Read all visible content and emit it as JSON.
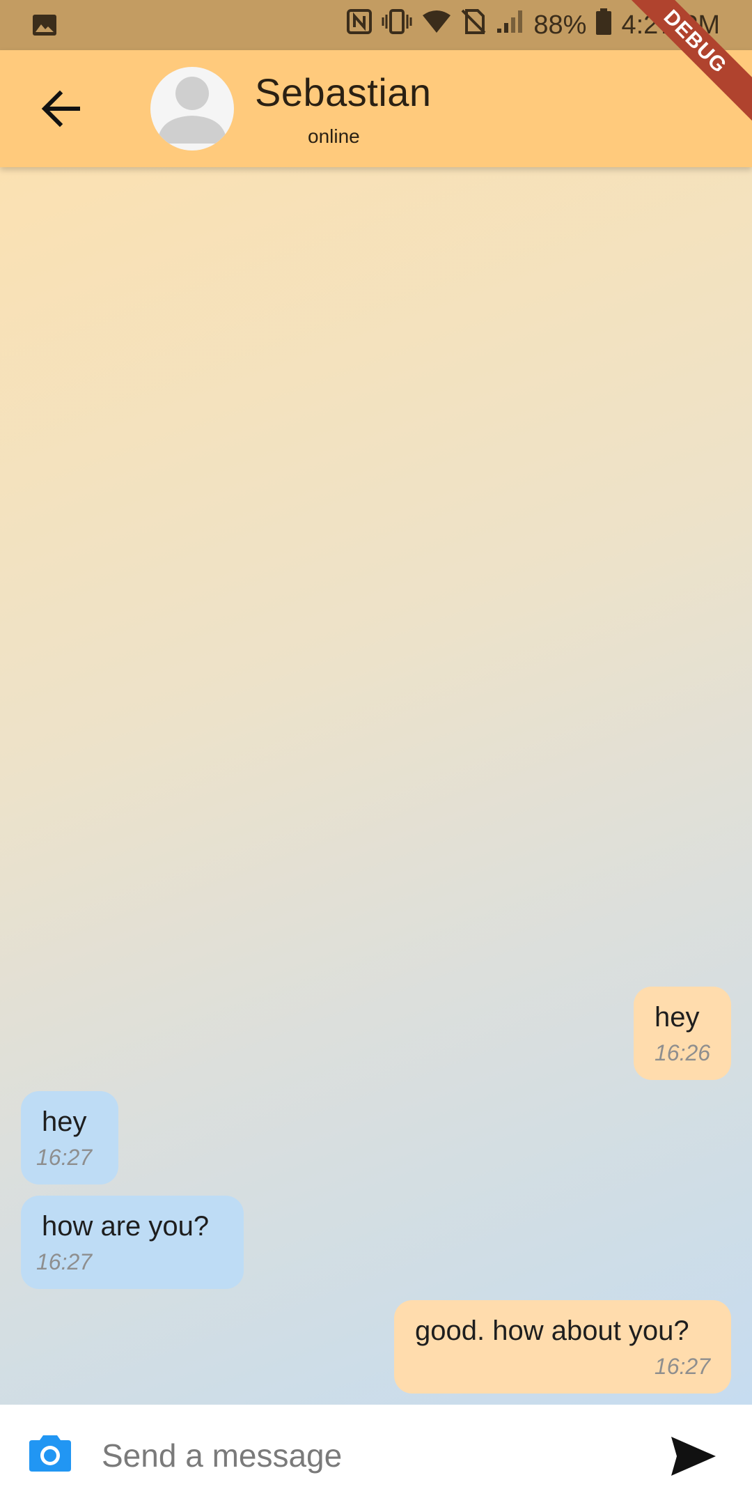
{
  "status_bar": {
    "battery": "88%",
    "time": "4:27 PM",
    "icons": [
      "image-icon",
      "nfc-icon",
      "vibrate-icon",
      "wifi-icon",
      "no-sim-icon",
      "signal-icon",
      "battery-icon"
    ]
  },
  "debug_banner": "DEBUG",
  "header": {
    "contact_name": "Sebastian",
    "contact_status": "online",
    "back_icon": "arrow-left-icon",
    "avatar_icon": "person-placeholder-icon"
  },
  "messages": [
    {
      "direction": "sent",
      "text": "hey",
      "time": "16:26"
    },
    {
      "direction": "received",
      "text": "hey",
      "time": "16:27"
    },
    {
      "direction": "received",
      "text": "how are you?",
      "time": "16:27"
    },
    {
      "direction": "sent",
      "text": "good. how about you?",
      "time": "16:27"
    }
  ],
  "composer": {
    "placeholder": "Send a message",
    "value": "",
    "camera_icon": "camera-icon",
    "send_icon": "send-icon"
  },
  "colors": {
    "status_bar": "#c39c62",
    "app_bar": "#ffca7c",
    "sent_bubble": "#ffdcad",
    "received_bubble": "#bedcf5",
    "camera_accent": "#2196f3",
    "debug_ribbon": "#b0432e"
  }
}
